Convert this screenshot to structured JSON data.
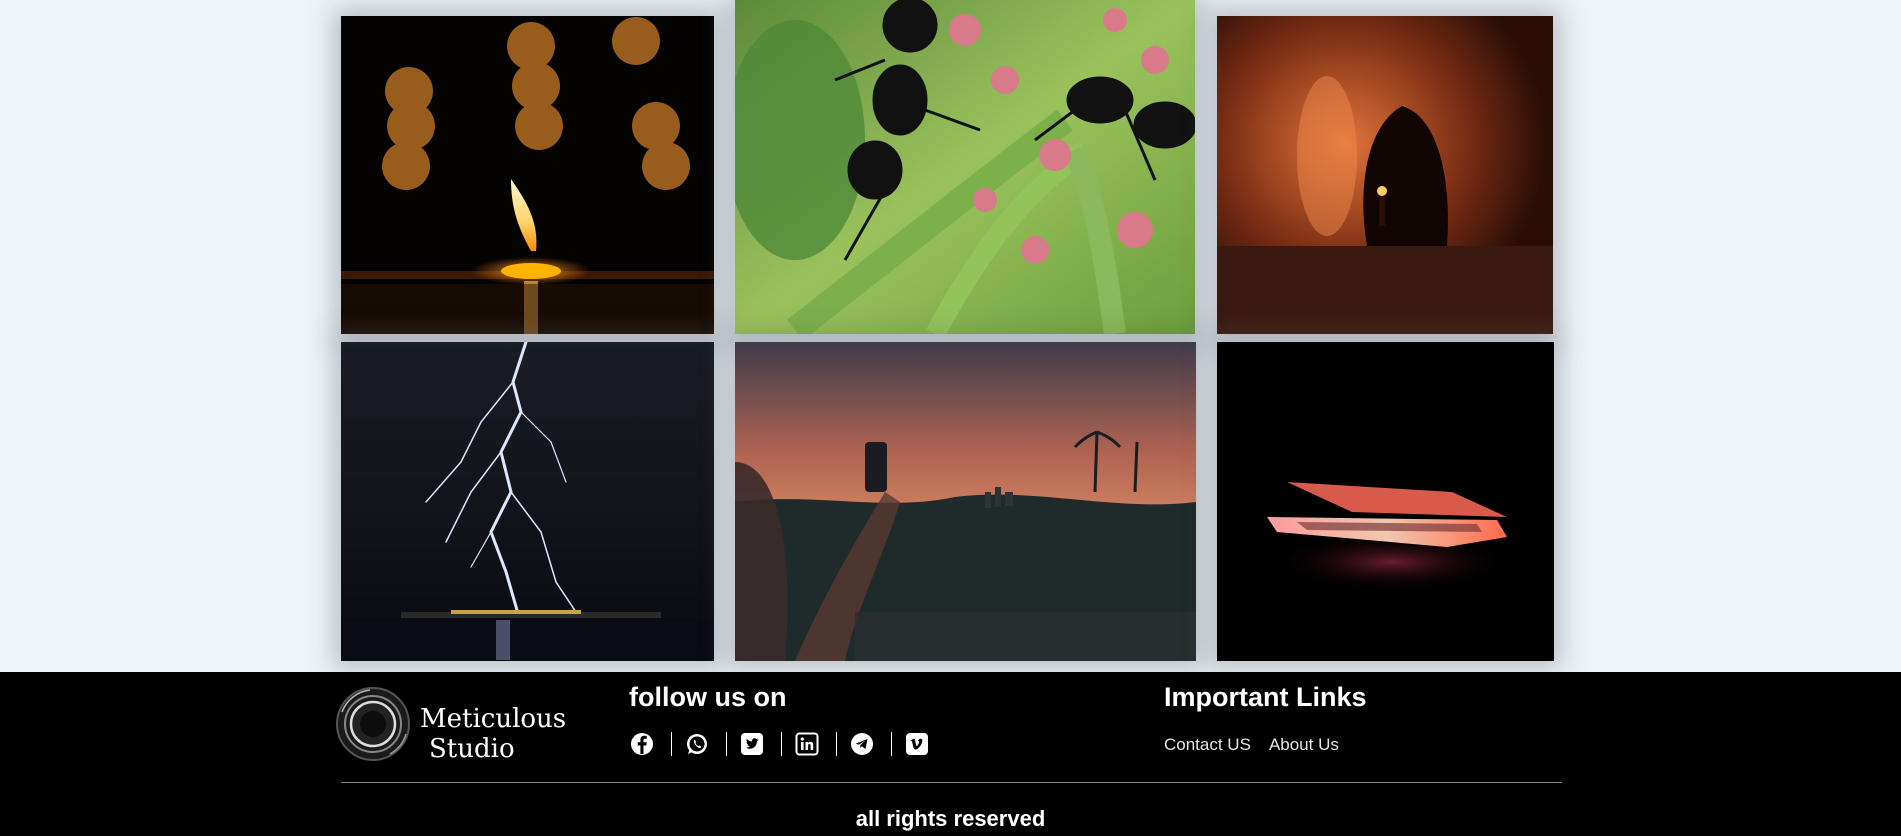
{
  "gallery": {
    "photos": [
      {
        "subject": "candle"
      },
      {
        "subject": "ants-on-plant"
      },
      {
        "subject": "cave-with-torch"
      },
      {
        "subject": "lightning"
      },
      {
        "subject": "sunset-city-phone"
      },
      {
        "subject": "glowing-laptop"
      }
    ]
  },
  "footer": {
    "logo": {
      "line1": "Meticulous",
      "line2": "Studio"
    },
    "follow_title": "follow us on",
    "social_icons": [
      "facebook-icon",
      "whatsapp-icon",
      "twitter-icon",
      "linkedin-icon",
      "telegram-icon",
      "vimeo-icon"
    ],
    "links_title": "Important Links",
    "links": [
      {
        "label": "Contact US"
      },
      {
        "label": "About Us"
      }
    ],
    "rights": "all rights reserved"
  },
  "colors": {
    "page_background": "#eef4f8",
    "footer_background": "#000000",
    "footer_text": "#ffffff"
  }
}
